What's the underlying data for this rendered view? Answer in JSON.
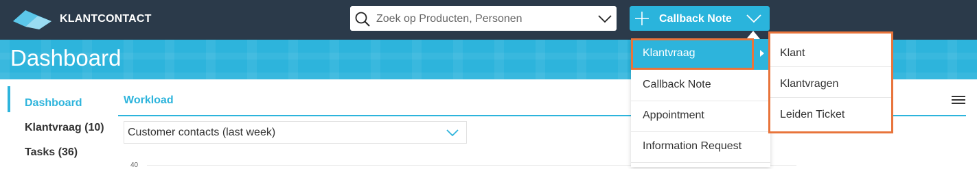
{
  "app": {
    "brand": "KLANTCONTACT"
  },
  "search": {
    "placeholder": "Zoek op Producten, Personen"
  },
  "callback_button": {
    "label": "Callback Note"
  },
  "page": {
    "title": "Dashboard"
  },
  "sidebar": {
    "items": [
      {
        "label": "Dashboard",
        "active": true
      },
      {
        "label": "Klantvraag (10)"
      },
      {
        "label": "Tasks (36)"
      }
    ]
  },
  "workload": {
    "title": "Workload",
    "select_value": "Customer contacts (last week)",
    "y_tick": "40"
  },
  "dropdown": {
    "items": [
      {
        "label": "Klantvraag",
        "selected": true
      },
      {
        "label": "Callback Note"
      },
      {
        "label": "Appointment"
      },
      {
        "label": "Information Request"
      }
    ]
  },
  "submenu": {
    "items": [
      {
        "label": "Klant"
      },
      {
        "label": "Klantvragen"
      },
      {
        "label": "Leiden Ticket"
      }
    ]
  },
  "colors": {
    "topbar": "#2b3a4a",
    "accent": "#2db4dc",
    "highlight": "#e8743b"
  },
  "icons": [
    "logo-icon",
    "search-icon",
    "chevron-down-icon",
    "plus-icon",
    "caret-right-icon",
    "hamburger-menu-icon"
  ]
}
